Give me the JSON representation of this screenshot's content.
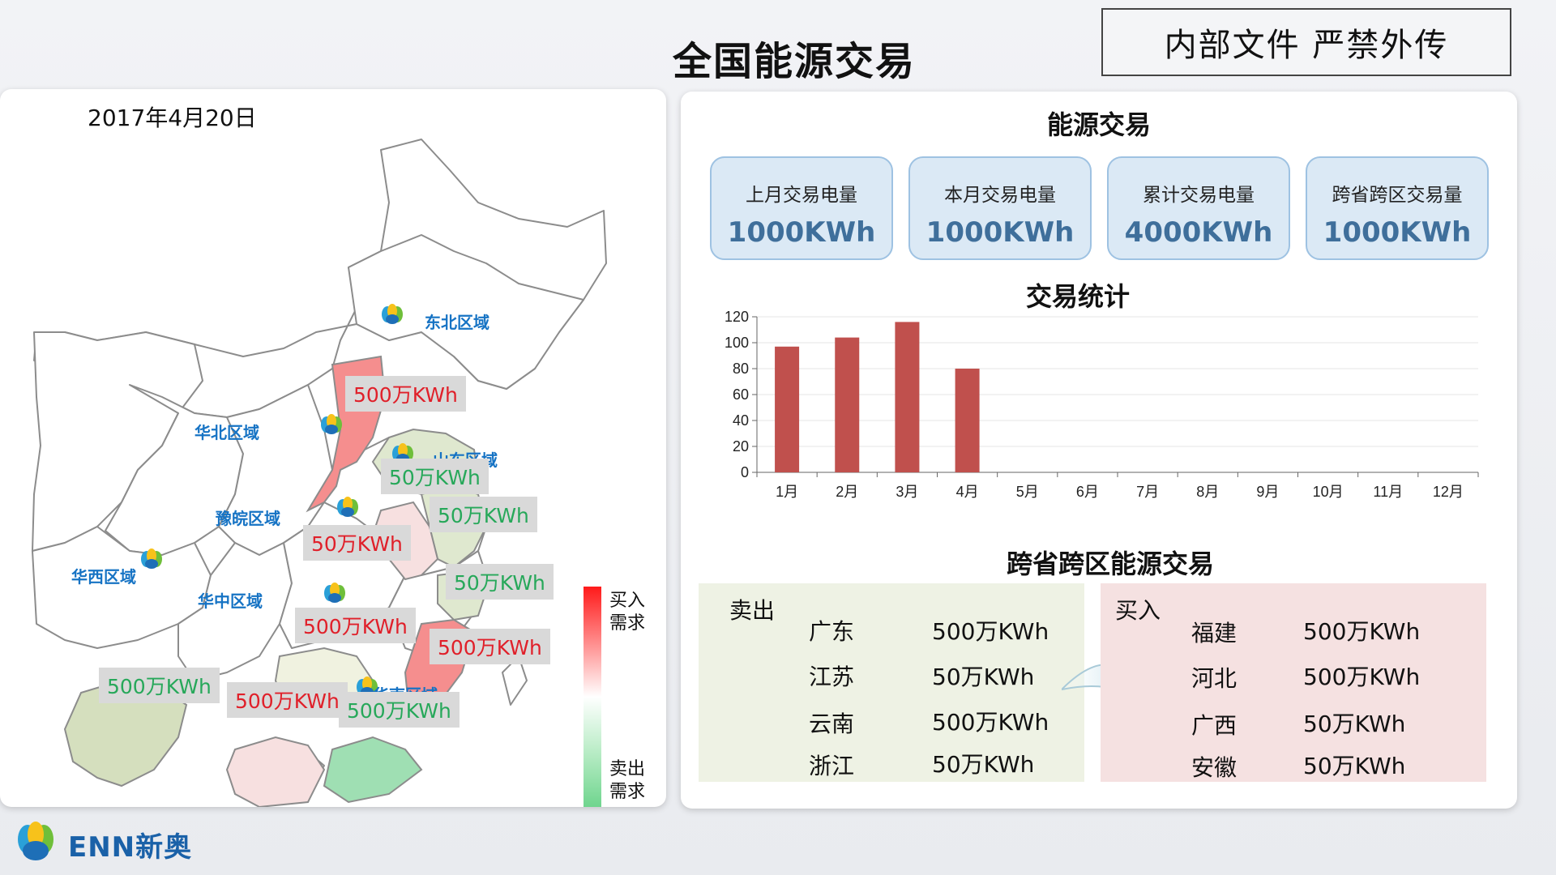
{
  "page": {
    "title": "全国能源交易",
    "confidential": "内部文件  严禁外传"
  },
  "map": {
    "date": "2017年4月20日",
    "regions": [
      "东北区域",
      "华北区域",
      "山东区域",
      "豫皖区域",
      "华西区域",
      "华中区域",
      "华南区域"
    ],
    "tags": [
      {
        "text": "500万KWh",
        "kind": "buy"
      },
      {
        "text": "50万KWh",
        "kind": "sell"
      },
      {
        "text": "50万KWh",
        "kind": "sell"
      },
      {
        "text": "50万KWh",
        "kind": "buy"
      },
      {
        "text": "50万KWh",
        "kind": "sell"
      },
      {
        "text": "500万KWh",
        "kind": "buy"
      },
      {
        "text": "500万KWh",
        "kind": "buy"
      },
      {
        "text": "500万KWh",
        "kind": "sell"
      },
      {
        "text": "500万KWh",
        "kind": "buy"
      },
      {
        "text": "500万KWh",
        "kind": "sell"
      }
    ],
    "legend": {
      "buy": "买入\n需求",
      "sell": "卖出\n需求"
    },
    "colors": {
      "buy": "#e0202a",
      "sell": "#27a85a",
      "region": "#1673c4"
    }
  },
  "energy": {
    "title": "能源交易",
    "cards": [
      {
        "label": "上月交易电量",
        "value": "1000KWh"
      },
      {
        "label": "本月交易电量",
        "value": "1000KWh"
      },
      {
        "label": "累计交易电量",
        "value": "4000KWh"
      },
      {
        "label": "跨省跨区交易量",
        "value": "1000KWh"
      }
    ]
  },
  "chart_data": {
    "type": "bar",
    "title": "交易统计",
    "categories": [
      "1月",
      "2月",
      "3月",
      "4月",
      "5月",
      "6月",
      "7月",
      "8月",
      "9月",
      "10月",
      "11月",
      "12月"
    ],
    "values": [
      97,
      104,
      116,
      80,
      null,
      null,
      null,
      null,
      null,
      null,
      null,
      null
    ],
    "ylim": [
      0,
      120
    ],
    "yticks": [
      0,
      20,
      40,
      60,
      80,
      100,
      120
    ],
    "grid": true,
    "bar_color": "#c0504d"
  },
  "cross": {
    "title": "跨省跨区能源交易",
    "sell": {
      "label": "卖出",
      "rows": [
        {
          "province": "广东",
          "value": "500万KWh"
        },
        {
          "province": "江苏",
          "value": "50万KWh"
        },
        {
          "province": "云南",
          "value": "500万KWh"
        },
        {
          "province": "浙江",
          "value": "50万KWh"
        }
      ]
    },
    "buy": {
      "label": "买入",
      "rows": [
        {
          "province": "福建",
          "value": "500万KWh"
        },
        {
          "province": "河北",
          "value": "500万KWh"
        },
        {
          "province": "广西",
          "value": "50万KWh"
        },
        {
          "province": "安徽",
          "value": "50万KWh"
        }
      ]
    }
  },
  "brand": {
    "name": "ENN新奥"
  }
}
